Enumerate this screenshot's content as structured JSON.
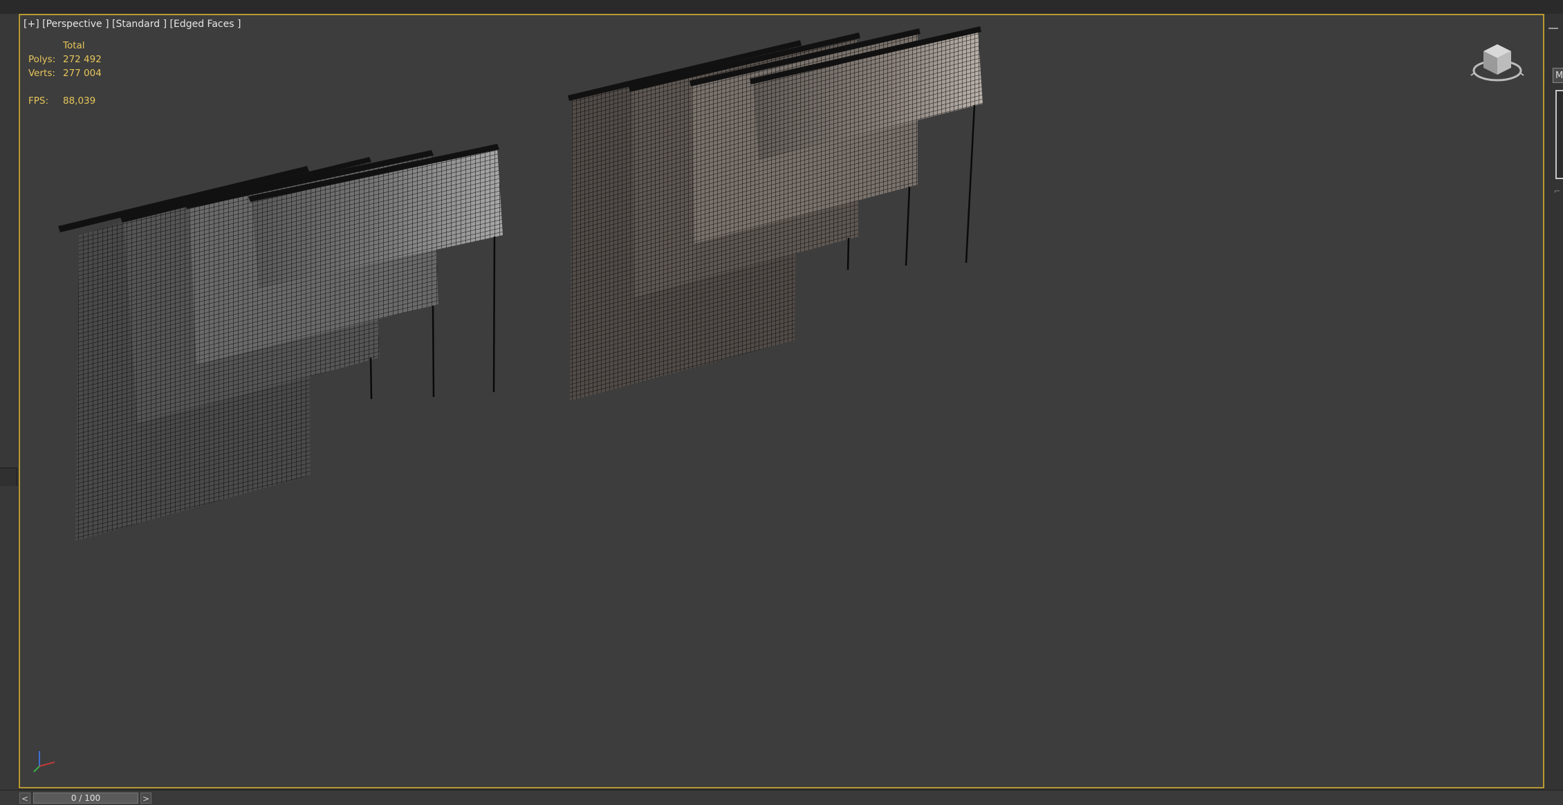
{
  "viewport": {
    "label": "[+] [Perspective ] [Standard ] [Edged Faces ]",
    "stats": {
      "header": "Total",
      "polys_label": "Polys:",
      "polys_value": "272 492",
      "verts_label": "Verts:",
      "verts_value": "277 004",
      "fps_label": "FPS:",
      "fps_value": "88,039"
    }
  },
  "right_panel": {
    "tab_label": "M"
  },
  "timeline": {
    "frame_display": "0 / 100",
    "prev_label": "<",
    "next_label": ">"
  },
  "colors": {
    "viewport_border": "#b79a33",
    "stats_text": "#e7c65a",
    "viewport_bg": "#3d3d3d"
  },
  "icons": {
    "viewcube": "viewcube-icon",
    "axis_tripod": "axis-tripod-icon"
  }
}
